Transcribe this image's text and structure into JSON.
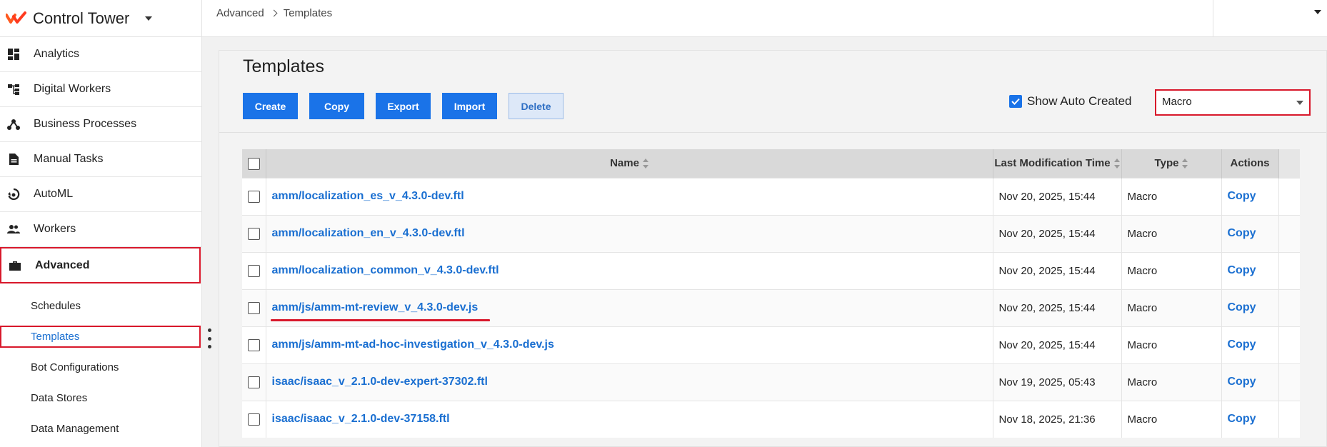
{
  "app": {
    "title": "Control Tower"
  },
  "breadcrumb": {
    "parent": "Advanced",
    "current": "Templates"
  },
  "sidebar": {
    "items": [
      {
        "label": "Analytics",
        "icon": "dashboard-icon"
      },
      {
        "label": "Digital Workers",
        "icon": "tree-icon"
      },
      {
        "label": "Business Processes",
        "icon": "process-icon"
      },
      {
        "label": "Manual Tasks",
        "icon": "document-icon"
      },
      {
        "label": "AutoML",
        "icon": "automl-icon"
      },
      {
        "label": "Workers",
        "icon": "people-icon"
      },
      {
        "label": "Advanced",
        "icon": "briefcase-icon"
      }
    ],
    "sub_items": [
      {
        "label": "Schedules"
      },
      {
        "label": "Templates"
      },
      {
        "label": "Bot Configurations"
      },
      {
        "label": "Data Stores"
      },
      {
        "label": "Data Management"
      }
    ]
  },
  "page": {
    "title": "Templates",
    "buttons": {
      "create": "Create",
      "copy": "Copy",
      "export": "Export",
      "import": "Import",
      "delete": "Delete"
    },
    "show_auto_created": {
      "label": "Show Auto Created",
      "checked": true
    },
    "type_filter": {
      "value": "Macro"
    }
  },
  "table": {
    "headers": {
      "name": "Name",
      "modified": "Last Modification Time",
      "type": "Type",
      "actions": "Actions"
    },
    "rows": [
      {
        "name": "amm/localization_es_v_4.3.0-dev.ftl",
        "modified": "Nov 20, 2025, 15:44",
        "type": "Macro",
        "action": "Copy"
      },
      {
        "name": "amm/localization_en_v_4.3.0-dev.ftl",
        "modified": "Nov 20, 2025, 15:44",
        "type": "Macro",
        "action": "Copy"
      },
      {
        "name": "amm/localization_common_v_4.3.0-dev.ftl",
        "modified": "Nov 20, 2025, 15:44",
        "type": "Macro",
        "action": "Copy"
      },
      {
        "name": "amm/js/amm-mt-review_v_4.3.0-dev.js",
        "modified": "Nov 20, 2025, 15:44",
        "type": "Macro",
        "action": "Copy"
      },
      {
        "name": "amm/js/amm-mt-ad-hoc-investigation_v_4.3.0-dev.js",
        "modified": "Nov 20, 2025, 15:44",
        "type": "Macro",
        "action": "Copy"
      },
      {
        "name": "isaac/isaac_v_2.1.0-dev-expert-37302.ftl",
        "modified": "Nov 19, 2025, 05:43",
        "type": "Macro",
        "action": "Copy"
      },
      {
        "name": "isaac/isaac_v_2.1.0-dev-37158.ftl",
        "modified": "Nov 18, 2025, 21:36",
        "type": "Macro",
        "action": "Copy"
      }
    ]
  },
  "colors": {
    "accent": "#1a73e8",
    "highlight": "#d8182b",
    "link": "#1a6fd1"
  }
}
